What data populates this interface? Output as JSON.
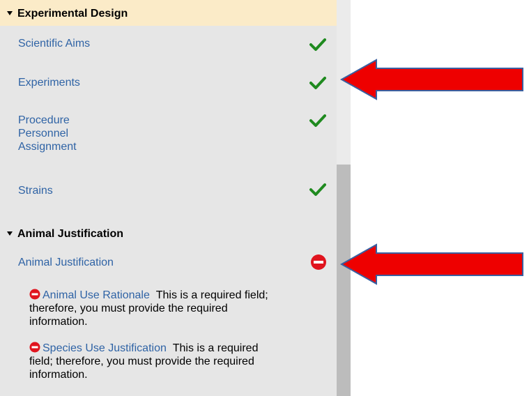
{
  "sections": [
    {
      "title": "Experimental Design",
      "items": [
        {
          "label": "Scientific Aims",
          "status": "complete"
        },
        {
          "label": "Experiments",
          "status": "complete"
        },
        {
          "label": "Procedure Personnel Assignment",
          "lines": [
            "Procedure",
            "Personnel",
            "Assignment"
          ],
          "status": "complete"
        },
        {
          "label": "Strains",
          "status": "complete"
        }
      ]
    },
    {
      "title": "Animal Justification",
      "items": [
        {
          "label": "Animal Justification",
          "status": "error"
        }
      ]
    }
  ],
  "requirements": [
    {
      "field": "Animal Use Rationale",
      "message_line1": "This is a required field;",
      "message_line2": "therefore, you must provide the required",
      "message_line3": "information."
    },
    {
      "field": "Species Use Justification",
      "message_line1": "This is a required",
      "message_line2": "field; therefore, you must provide the required",
      "message_line3": "information."
    }
  ],
  "colors": {
    "link": "#2f63a5",
    "check": "#1f8a1f",
    "error": "#e0141e",
    "arrow": "#ee0000",
    "arrow_border": "#3a5fa0",
    "header_highlight": "#fbebc8",
    "panel_bg": "#e6e6e6"
  },
  "icons": {
    "complete": "check-icon",
    "error": "no-entry-icon",
    "expand": "caret-down-icon",
    "annotation": "red-arrow"
  }
}
